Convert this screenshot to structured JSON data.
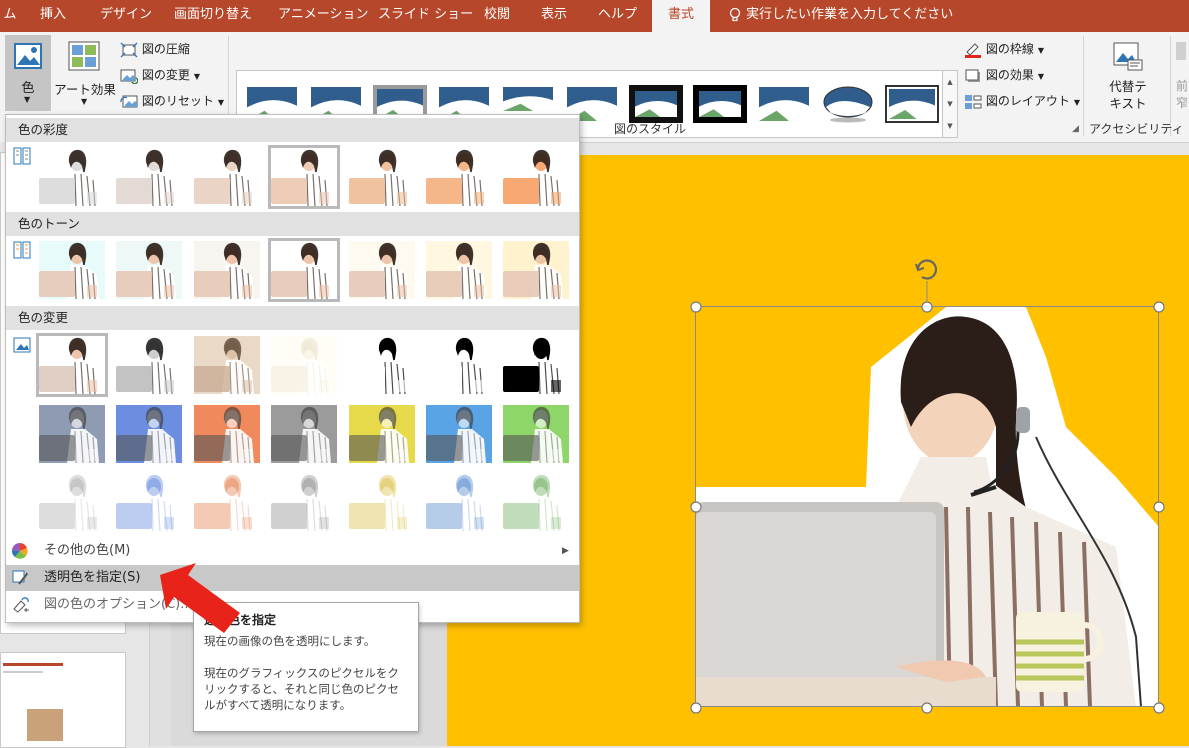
{
  "tabs": [
    {
      "label": "ム"
    },
    {
      "label": "挿入"
    },
    {
      "label": "デザイン"
    },
    {
      "label": "画面切り替え"
    },
    {
      "label": "アニメーション"
    },
    {
      "label": "スライド ショー"
    },
    {
      "label": "校閲"
    },
    {
      "label": "表示"
    },
    {
      "label": "ヘルプ"
    },
    {
      "label": "書式"
    }
  ],
  "tell_me": "実行したい作業を入力してください",
  "ribbon": {
    "color_label": "色",
    "art_effects_label": "アート効果",
    "compress_label": "図の圧縮",
    "change_label": "図の変更",
    "reset_label": "図のリセット",
    "border_label": "図の枠線",
    "effects_label": "図の効果",
    "layout_label": "図のレイアウト",
    "alt_text_line1": "代替テ",
    "alt_text_line2": "キスト",
    "styles_group": "図のスタイル",
    "accessibility_group": "アクセシビリティ",
    "cut_line1": "前",
    "cut_line2": "窄"
  },
  "dropdown": {
    "saturation_header": "色の彩度",
    "tone_header": "色のトーン",
    "recolor_header": "色の変更",
    "more_colors": "その他の色(M)",
    "set_transparent": "透明色を指定(S)",
    "color_options": "図の色のオプション(C)..."
  },
  "tooltip": {
    "title": "透明色を指定",
    "line1": "現在の画像の色を透明にします。",
    "line2": "現在のグラフィックスのピクセルをクリックすると、それと同じ色のピクセルがすべて透明になります。"
  },
  "colors": {
    "accent": "#b7472a",
    "slide_bg": "#ffc000",
    "arrow": "#e8231a",
    "highlight": "#c8c8c8"
  }
}
